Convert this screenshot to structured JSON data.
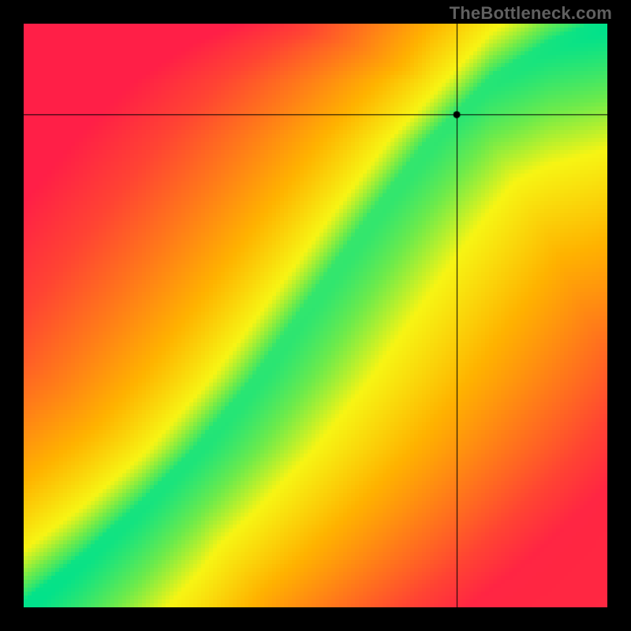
{
  "watermark": "TheBottleneck.com",
  "chart_data": {
    "type": "heatmap",
    "title": "",
    "xlabel": "",
    "ylabel": "",
    "xlim": [
      0,
      1
    ],
    "ylim": [
      0,
      1
    ],
    "grid": false,
    "legend": "none",
    "marker": {
      "x": 0.742,
      "y": 0.844
    },
    "crosshair": {
      "x": 0.742,
      "y": 0.844
    },
    "ridge": {
      "description": "Green optimal-balance ridge through the heatmap, roughly monotone increasing with slight S-curve",
      "points_xy": [
        [
          0.0,
          0.0
        ],
        [
          0.1,
          0.08
        ],
        [
          0.2,
          0.17
        ],
        [
          0.3,
          0.27
        ],
        [
          0.4,
          0.39
        ],
        [
          0.5,
          0.53
        ],
        [
          0.6,
          0.67
        ],
        [
          0.7,
          0.8
        ],
        [
          0.8,
          0.9
        ],
        [
          0.9,
          0.96
        ],
        [
          1.0,
          1.0
        ]
      ],
      "half_width_frac": 0.055
    },
    "colorscale": {
      "description": "Distance from ridge mapped through green→yellow→orange→red; upper-left quadrant far side biased redder, lower-right far side biased toward orange/yellow fade",
      "stops": [
        [
          0.0,
          "#00E28C"
        ],
        [
          0.1,
          "#6CEB4C"
        ],
        [
          0.2,
          "#F7F514"
        ],
        [
          0.4,
          "#FFB300"
        ],
        [
          0.6,
          "#FF7A1A"
        ],
        [
          0.8,
          "#FF4433"
        ],
        [
          1.0,
          "#FF1F47"
        ]
      ]
    },
    "resolution": {
      "cols": 148,
      "rows": 148
    }
  }
}
